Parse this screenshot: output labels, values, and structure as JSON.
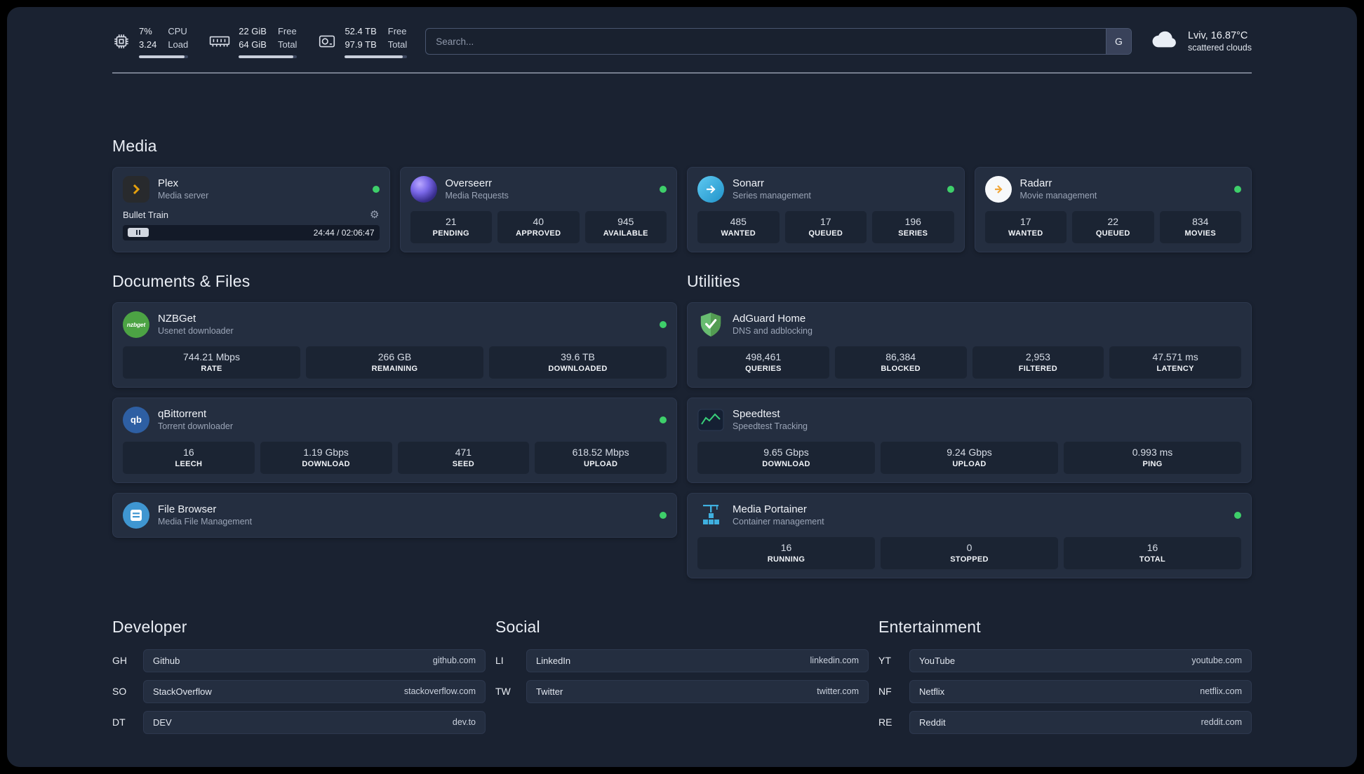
{
  "colors": {
    "background": "#1a2231",
    "card": "#242e40",
    "stat_tile": "#1b2433",
    "status_online": "#3ecf6a",
    "plex_amber": "#e5a00d"
  },
  "icons": {
    "gear_glyph": "⚙",
    "qb_text": "qb",
    "nzbget_text": "nzbget"
  },
  "topbar": {
    "cpu": {
      "value_top": "7%",
      "value_bottom": "3.24",
      "label_top": "CPU",
      "label_bottom": "Load"
    },
    "memory": {
      "value_top": "22 GiB",
      "value_bottom": "64 GiB",
      "label_top": "Free",
      "label_bottom": "Total"
    },
    "disk": {
      "value_top": "52.4 TB",
      "value_bottom": "97.9 TB",
      "label_top": "Free",
      "label_bottom": "Total"
    },
    "search": {
      "placeholder": "Search...",
      "button": "G"
    },
    "weather": {
      "location": "Lviv, 16.87°C",
      "condition": "scattered clouds"
    }
  },
  "sections": {
    "media": "Media",
    "documents": "Documents & Files",
    "utilities": "Utilities",
    "developer": "Developer",
    "social": "Social",
    "entertainment": "Entertainment"
  },
  "media_apps": {
    "plex": {
      "name": "Plex",
      "subtitle": "Media server",
      "status": "online",
      "player": {
        "track": "Bullet Train",
        "time": "24:44 / 02:06:47"
      }
    },
    "overseerr": {
      "name": "Overseerr",
      "subtitle": "Media Requests",
      "status": "online",
      "stats": [
        {
          "value": "21",
          "label": "PENDING"
        },
        {
          "value": "40",
          "label": "APPROVED"
        },
        {
          "value": "945",
          "label": "AVAILABLE"
        }
      ]
    },
    "sonarr": {
      "name": "Sonarr",
      "subtitle": "Series management",
      "status": "online",
      "stats": [
        {
          "value": "485",
          "label": "WANTED"
        },
        {
          "value": "17",
          "label": "QUEUED"
        },
        {
          "value": "196",
          "label": "SERIES"
        }
      ]
    },
    "radarr": {
      "name": "Radarr",
      "subtitle": "Movie management",
      "status": "online",
      "stats": [
        {
          "value": "17",
          "label": "WANTED"
        },
        {
          "value": "22",
          "label": "QUEUED"
        },
        {
          "value": "834",
          "label": "MOVIES"
        }
      ]
    }
  },
  "documents_apps": {
    "nzbget": {
      "name": "NZBGet",
      "subtitle": "Usenet downloader",
      "status": "online",
      "stats": [
        {
          "value": "744.21 Mbps",
          "label": "RATE"
        },
        {
          "value": "266 GB",
          "label": "REMAINING"
        },
        {
          "value": "39.6 TB",
          "label": "DOWNLOADED"
        }
      ]
    },
    "qbittorrent": {
      "name": "qBittorrent",
      "subtitle": "Torrent downloader",
      "status": "online",
      "stats": [
        {
          "value": "16",
          "label": "LEECH"
        },
        {
          "value": "1.19 Gbps",
          "label": "DOWNLOAD"
        },
        {
          "value": "471",
          "label": "SEED"
        },
        {
          "value": "618.52 Mbps",
          "label": "UPLOAD"
        }
      ]
    },
    "filebrowser": {
      "name": "File Browser",
      "subtitle": "Media File Management",
      "status": "online"
    }
  },
  "utilities_apps": {
    "adguard": {
      "name": "AdGuard Home",
      "subtitle": "DNS and adblocking",
      "stats": [
        {
          "value": "498,461",
          "label": "QUERIES"
        },
        {
          "value": "86,384",
          "label": "BLOCKED"
        },
        {
          "value": "2,953",
          "label": "FILTERED"
        },
        {
          "value": "47.571 ms",
          "label": "LATENCY"
        }
      ]
    },
    "speedtest": {
      "name": "Speedtest",
      "subtitle": "Speedtest Tracking",
      "stats": [
        {
          "value": "9.65 Gbps",
          "label": "DOWNLOAD"
        },
        {
          "value": "9.24 Gbps",
          "label": "UPLOAD"
        },
        {
          "value": "0.993 ms",
          "label": "PING"
        }
      ]
    },
    "portainer": {
      "name": "Media Portainer",
      "subtitle": "Container management",
      "status": "online",
      "stats": [
        {
          "value": "16",
          "label": "RUNNING"
        },
        {
          "value": "0",
          "label": "STOPPED"
        },
        {
          "value": "16",
          "label": "TOTAL"
        }
      ]
    }
  },
  "bookmarks": {
    "developer": [
      {
        "abbr": "GH",
        "name": "Github",
        "url": "github.com"
      },
      {
        "abbr": "SO",
        "name": "StackOverflow",
        "url": "stackoverflow.com"
      },
      {
        "abbr": "DT",
        "name": "DEV",
        "url": "dev.to"
      }
    ],
    "social": [
      {
        "abbr": "LI",
        "name": "LinkedIn",
        "url": "linkedin.com"
      },
      {
        "abbr": "TW",
        "name": "Twitter",
        "url": "twitter.com"
      }
    ],
    "entertainment": [
      {
        "abbr": "YT",
        "name": "YouTube",
        "url": "youtube.com"
      },
      {
        "abbr": "NF",
        "name": "Netflix",
        "url": "netflix.com"
      },
      {
        "abbr": "RE",
        "name": "Reddit",
        "url": "reddit.com"
      }
    ]
  }
}
